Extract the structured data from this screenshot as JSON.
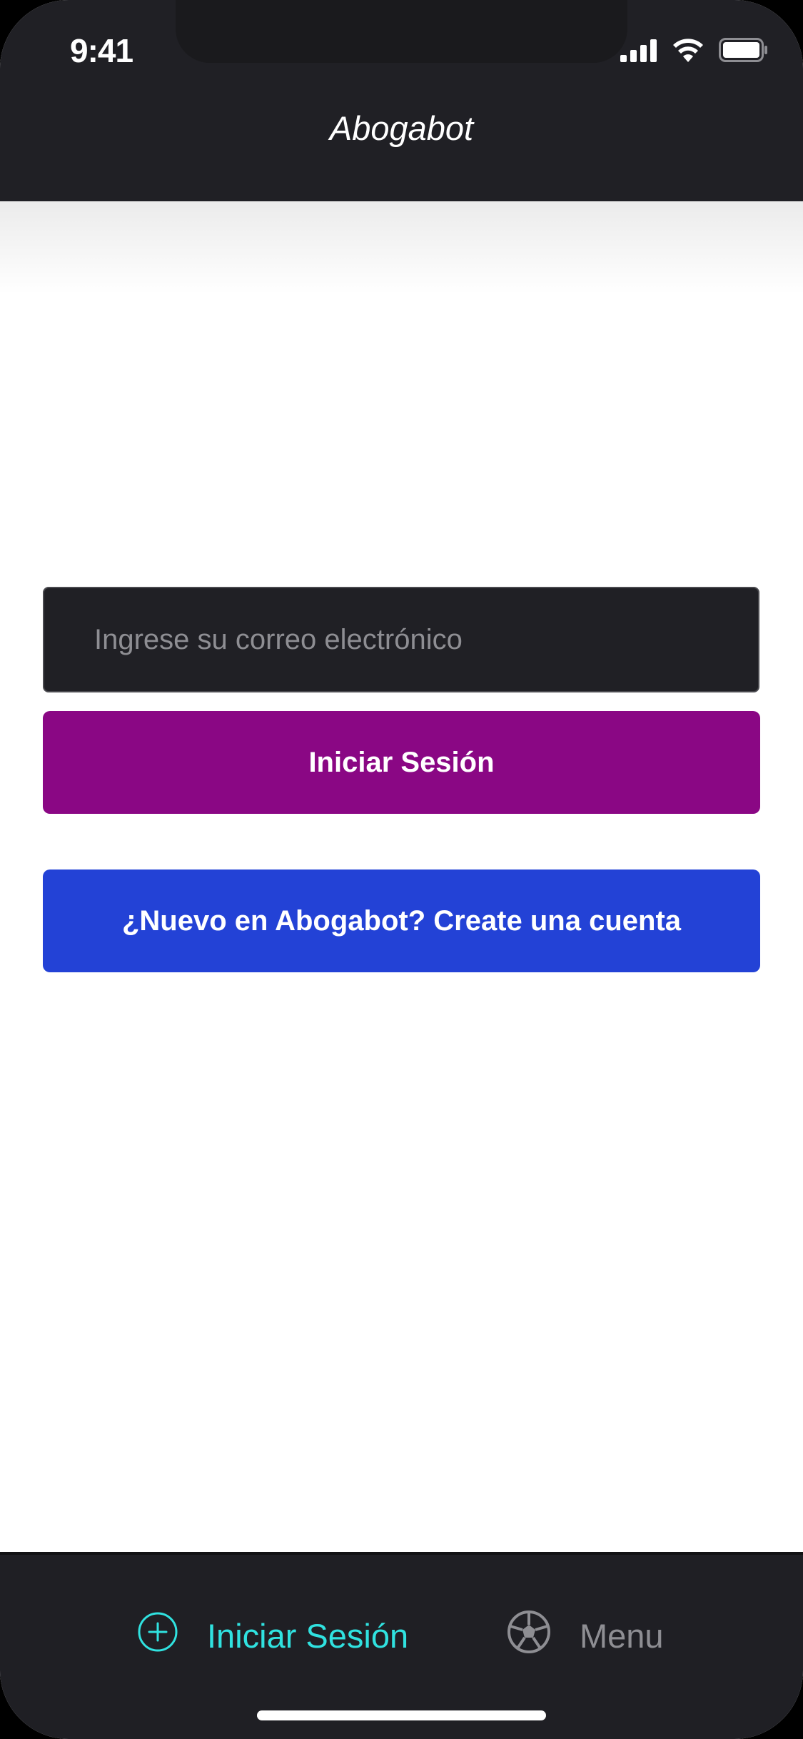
{
  "status_bar": {
    "time": "9:41",
    "icons": [
      "cellular-signal-icon",
      "wifi-icon",
      "battery-icon"
    ]
  },
  "header": {
    "title": "Abogabot"
  },
  "form": {
    "email_placeholder": "Ingrese su correo electrónico",
    "email_value": "",
    "login_label": "Iniciar Sesión",
    "create_account_label": "¿Nuevo en Abogabot? Create una cuenta"
  },
  "tabbar": {
    "items": [
      {
        "label": "Iniciar Sesión",
        "icon": "plus-circle-icon",
        "active": true
      },
      {
        "label": "Menu",
        "icon": "soccer-ball-icon",
        "active": false
      }
    ]
  },
  "colors": {
    "header_bg": "#202025",
    "login_button": "#8a0784",
    "create_button": "#2342d6",
    "tab_active": "#30e2e0",
    "tab_inactive": "#8e8e93",
    "tabbar_bg": "#1f1f24"
  }
}
